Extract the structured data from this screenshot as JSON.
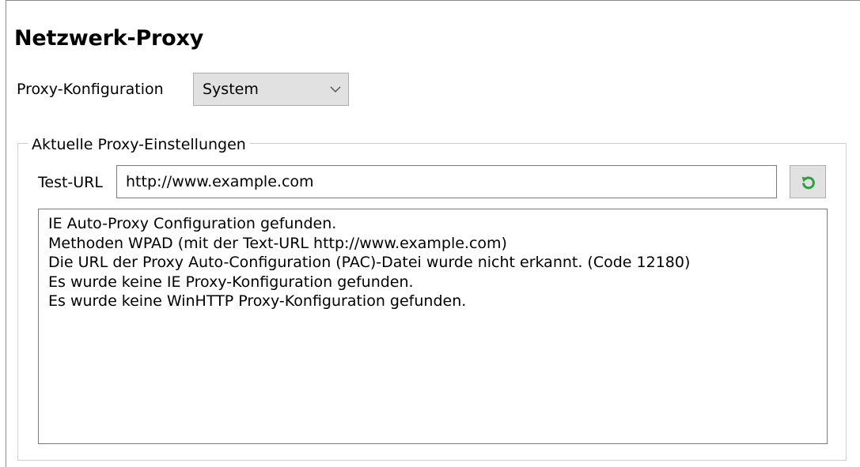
{
  "section": {
    "title": "Netzwerk-Proxy"
  },
  "proxy_config": {
    "label": "Proxy-Konfiguration",
    "selected": "System"
  },
  "current_settings": {
    "legend": "Aktuelle Proxy-Einstellungen",
    "test_url_label": "Test-URL",
    "test_url_value": "http://www.example.com",
    "refresh_icon": "refresh-icon",
    "refresh_icon_color": "#2e9e3f",
    "output_lines": [
      "IE Auto-Proxy Configuration gefunden.",
      "Methoden WPAD (mit der Text-URL http://www.example.com)",
      "Die URL der Proxy Auto-Configuration (PAC)-Datei wurde nicht erkannt. (Code 12180)",
      "Es wurde keine IE Proxy-Konfiguration gefunden.",
      "Es wurde keine WinHTTP Proxy-Konfiguration gefunden."
    ]
  }
}
